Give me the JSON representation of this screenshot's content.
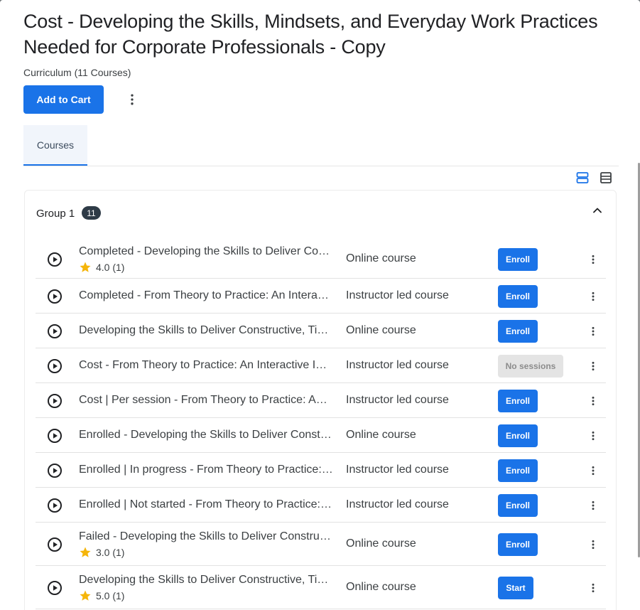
{
  "header": {
    "title": "Cost - Developing the Skills, Mindsets, and Everyday Work Practices Needed for Corporate Professionals - Copy",
    "subtitle": "Curriculum (11 Courses)",
    "add_to_cart_label": "Add to Cart"
  },
  "tabs": [
    {
      "label": "Courses",
      "active": true
    }
  ],
  "group": {
    "title": "Group 1",
    "count": "11",
    "expanded": true
  },
  "courses": [
    {
      "name": "Completed - Developing the Skills to Deliver Constructive, Timely Feedback",
      "rating": "4.0 (1)",
      "type": "Online course",
      "action": "Enroll"
    },
    {
      "name": "Completed - From Theory to Practice: An Interactive Instructor Led Course",
      "rating": "",
      "type": "Instructor led course",
      "action": "Enroll"
    },
    {
      "name": "Developing the Skills to Deliver Constructive, Timely Feedback",
      "rating": "",
      "type": "Online course",
      "action": "Enroll"
    },
    {
      "name": "Cost - From Theory to Practice: An Interactive Instructor Led Course",
      "rating": "",
      "type": "Instructor led course",
      "action": "No sessions"
    },
    {
      "name": "Cost | Per session - From Theory to Practice: An Interactive Instructor Led Course",
      "rating": "",
      "type": "Instructor led course",
      "action": "Enroll"
    },
    {
      "name": "Enrolled - Developing the Skills to Deliver Constructive, Timely Feedback",
      "rating": "",
      "type": "Online course",
      "action": "Enroll"
    },
    {
      "name": "Enrolled | In progress - From Theory to Practice: An Interactive Instructor Led Course",
      "rating": "",
      "type": "Instructor led course",
      "action": "Enroll"
    },
    {
      "name": "Enrolled | Not started - From Theory to Practice: An Interactive Instructor Led Course",
      "rating": "",
      "type": "Instructor led course",
      "action": "Enroll"
    },
    {
      "name": "Failed - Developing the Skills to Deliver Constructive, Timely Feedback",
      "rating": "3.0 (1)",
      "type": "Online course",
      "action": "Enroll"
    },
    {
      "name": "Developing the Skills to Deliver Constructive, Timely Feedback",
      "rating": "5.0 (1)",
      "type": "Online course",
      "action": "Start"
    }
  ],
  "icons": {
    "more": "more-vert-icon",
    "play": "play-circle-icon",
    "star": "star-icon",
    "collapse": "chevron-up-icon",
    "view_card": "card-view-icon",
    "view_list": "list-view-icon"
  },
  "colors": {
    "primary": "#1a73e8",
    "star": "#f5b50a",
    "badge": "#2e3b47"
  }
}
